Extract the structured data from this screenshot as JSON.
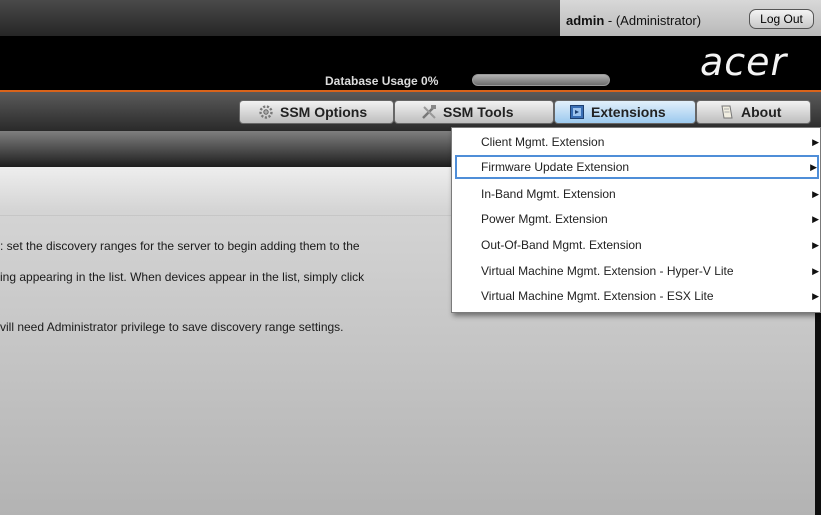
{
  "userbar": {
    "user_name": "admin",
    "user_role": " - (Administrator)",
    "logout_label": "Log Out"
  },
  "header": {
    "db_usage_label": "Database Usage 0%",
    "db_usage_percent": 0,
    "logo_text": "acer"
  },
  "menubar": {
    "items": [
      {
        "label": "SSM Options",
        "icon": "gear-icon"
      },
      {
        "label": "SSM Tools",
        "icon": "tools-icon"
      },
      {
        "label": "Extensions",
        "icon": "extension-icon"
      },
      {
        "label": "About",
        "icon": "book-icon"
      }
    ]
  },
  "extensions_menu": {
    "items": [
      {
        "label": "Client Mgmt. Extension",
        "has_submenu": true
      },
      {
        "label": "Firmware Update Extension",
        "has_submenu": true
      },
      {
        "label": "In-Band Mgmt. Extension",
        "has_submenu": true
      },
      {
        "label": "Power Mgmt. Extension",
        "has_submenu": true
      },
      {
        "label": "Out-Of-Band Mgmt. Extension",
        "has_submenu": true
      },
      {
        "label": "Virtual Machine Mgmt. Extension - Hyper-V Lite",
        "has_submenu": true
      },
      {
        "label": "Virtual Machine Mgmt. Extension - ESX Lite",
        "has_submenu": true
      }
    ],
    "highlighted_index": 1,
    "arrow_glyph": "▶"
  },
  "content": {
    "lines": [
      ": set the discovery ranges for the server to begin adding them to the",
      "ing appearing in the list. When devices appear in the list, simply click",
      "vill need Administrator privilege to save discovery range settings."
    ]
  },
  "colors": {
    "accent_orange": "#d9631a",
    "highlight_blue": "#4f8ed8"
  }
}
